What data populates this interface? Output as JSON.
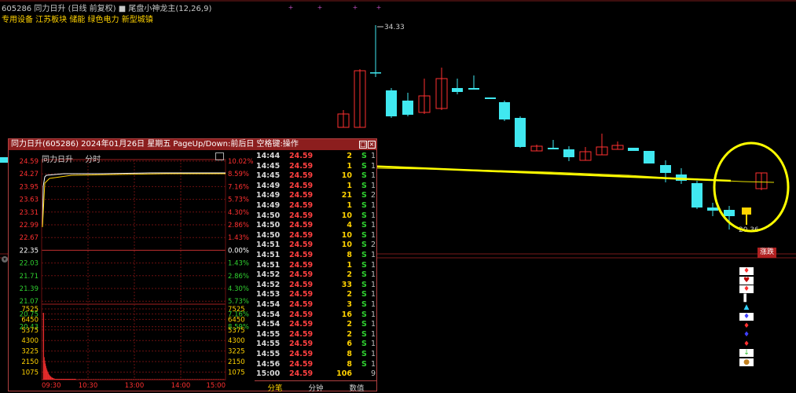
{
  "header": {
    "line1_code": "605286",
    "line1_name": "同力日升",
    "line1_period": "(日线 前复权)",
    "line1_indicator": "尾盘小神龙主",
    "line1_params": "(12,26,9)",
    "line2": "专用设备 江苏板块 储能 绿色电力 新型城镇"
  },
  "main_chart": {
    "high_label": "34.33",
    "low_label": "20.36",
    "right_badge": "涨跌",
    "colors": {
      "up": "#ff3030",
      "down": "#40e8f0",
      "ma": "#e8e000",
      "highlight": "#ffff00"
    }
  },
  "popup": {
    "title": "同力日升(605286) 2024年01月26日 星期五 PageUp/Down:前后日 空格键:操作",
    "subtitle_name": "同力日升",
    "subtitle_mode": "分时",
    "left_axis": [
      "24.59",
      "24.27",
      "23.95",
      "23.63",
      "23.31",
      "22.99",
      "22.67",
      "22.35",
      "22.03",
      "21.71",
      "21.39",
      "21.07",
      "20.75",
      "20.43"
    ],
    "right_axis": [
      "10.02%",
      "8.59%",
      "7.16%",
      "5.73%",
      "4.30%",
      "2.86%",
      "1.43%",
      "0.00%",
      "1.43%",
      "2.86%",
      "4.30%",
      "5.73%",
      "7.16%",
      "8.59%"
    ],
    "vol_axis": [
      "7525",
      "6450",
      "5375",
      "4300",
      "3225",
      "2150",
      "1075"
    ],
    "time_axis": [
      "09:30",
      "10:30",
      "13:00",
      "14:00",
      "15:00"
    ],
    "ticks": [
      {
        "time": "14:44",
        "price": "24.59",
        "vol": "2",
        "side": "S",
        "n": "1"
      },
      {
        "time": "14:45",
        "price": "24.59",
        "vol": "1",
        "side": "S",
        "n": "1"
      },
      {
        "time": "14:45",
        "price": "24.59",
        "vol": "10",
        "side": "S",
        "n": "1"
      },
      {
        "time": "14:49",
        "price": "24.59",
        "vol": "1",
        "side": "S",
        "n": "1"
      },
      {
        "time": "14:49",
        "price": "24.59",
        "vol": "21",
        "side": "S",
        "n": "2"
      },
      {
        "time": "14:49",
        "price": "24.59",
        "vol": "1",
        "side": "S",
        "n": "1"
      },
      {
        "time": "14:50",
        "price": "24.59",
        "vol": "10",
        "side": "S",
        "n": "1"
      },
      {
        "time": "14:50",
        "price": "24.59",
        "vol": "4",
        "side": "S",
        "n": "1"
      },
      {
        "time": "14:50",
        "price": "24.59",
        "vol": "10",
        "side": "S",
        "n": "1"
      },
      {
        "time": "14:51",
        "price": "24.59",
        "vol": "10",
        "side": "S",
        "n": "2"
      },
      {
        "time": "14:51",
        "price": "24.59",
        "vol": "8",
        "side": "S",
        "n": "1"
      },
      {
        "time": "14:51",
        "price": "24.59",
        "vol": "1",
        "side": "S",
        "n": "1"
      },
      {
        "time": "14:52",
        "price": "24.59",
        "vol": "2",
        "side": "S",
        "n": "1"
      },
      {
        "time": "14:52",
        "price": "24.59",
        "vol": "33",
        "side": "S",
        "n": "1"
      },
      {
        "time": "14:53",
        "price": "24.59",
        "vol": "2",
        "side": "S",
        "n": "1"
      },
      {
        "time": "14:54",
        "price": "24.59",
        "vol": "3",
        "side": "S",
        "n": "1"
      },
      {
        "time": "14:54",
        "price": "24.59",
        "vol": "16",
        "side": "S",
        "n": "1"
      },
      {
        "time": "14:54",
        "price": "24.59",
        "vol": "2",
        "side": "S",
        "n": "1"
      },
      {
        "time": "14:55",
        "price": "24.59",
        "vol": "2",
        "side": "S",
        "n": "1"
      },
      {
        "time": "14:55",
        "price": "24.59",
        "vol": "6",
        "side": "S",
        "n": "1"
      },
      {
        "time": "14:55",
        "price": "24.59",
        "vol": "8",
        "side": "S",
        "n": "1"
      },
      {
        "time": "14:56",
        "price": "24.59",
        "vol": "8",
        "side": "S",
        "n": "1"
      },
      {
        "time": "15:00",
        "price": "24.59",
        "vol": "106",
        "side": "",
        "n": "9"
      }
    ],
    "tabs": [
      "分笔",
      "分钟",
      "数值"
    ]
  }
}
